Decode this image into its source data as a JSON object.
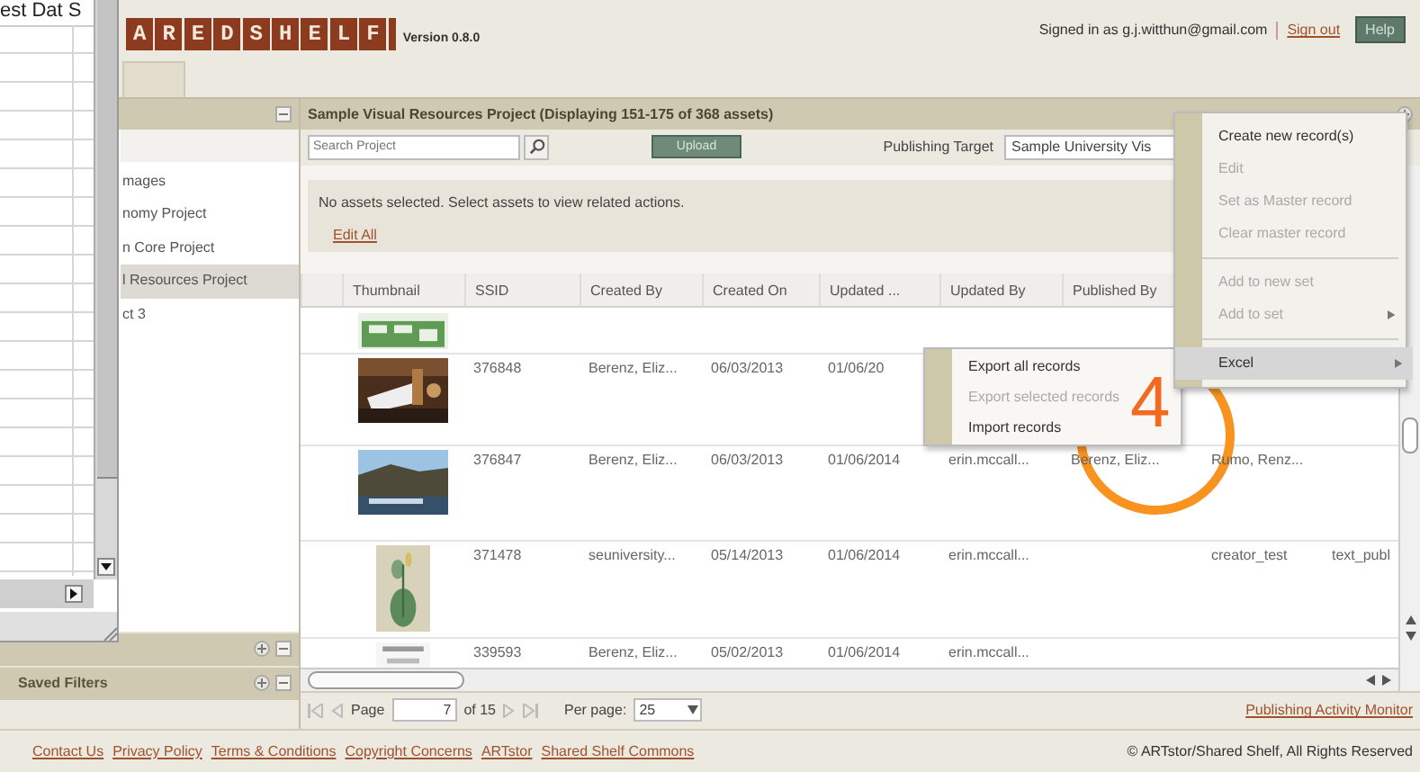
{
  "spreadsheet": {
    "header": "est Dat S"
  },
  "header": {
    "logo": "AREDSHELF",
    "version": "Version 0.8.0",
    "signed_in": "Signed in as g.j.witthun@gmail.com",
    "sign_out": "Sign out",
    "help": "Help"
  },
  "projects": [
    {
      "label": "mages",
      "selected": false
    },
    {
      "label": "nomy Project",
      "selected": false
    },
    {
      "label": "n Core Project",
      "selected": false
    },
    {
      "label": "l Resources Project",
      "selected": true
    },
    {
      "label": "ct 3",
      "selected": false
    }
  ],
  "saved_filters": "Saved Filters",
  "main": {
    "title": "Sample Visual Resources Project (Displaying 151-175 of 368 assets)",
    "search_placeholder": "Search Project",
    "upload": "Upload",
    "publishing_label": "Publishing Target",
    "publishing_value": "Sample University Vis",
    "notice": "No assets selected.  Select assets to view related actions.",
    "edit_all": "Edit All"
  },
  "table": {
    "columns": [
      "Thumbnail",
      "SSID",
      "Created By",
      "Created On",
      "Updated ...",
      "Updated By",
      "Published By"
    ],
    "rows": [
      {
        "cells": [
          {
            "kind": "picture"
          },
          null,
          null,
          null,
          null,
          null,
          null,
          null,
          null
        ]
      },
      {
        "cells": [
          {
            "kind": "picture"
          },
          "376848",
          "Berenz, Eliz...",
          "06/03/2013",
          "01/06/20",
          null,
          null,
          null,
          null
        ]
      },
      {
        "cells": [
          {
            "kind": "picture"
          },
          "376847",
          "Berenz, Eliz...",
          "06/03/2013",
          "01/06/2014",
          "erin.mccall...",
          "Berenz, Eliz...",
          "Rumo, Renz...",
          null
        ]
      },
      {
        "cells": [
          {
            "kind": "picture"
          },
          "371478",
          "seuniversity...",
          "05/14/2013",
          "01/06/2014",
          "erin.mccall...",
          null,
          "creator_test",
          "text_publ"
        ]
      },
      {
        "cells": [
          {
            "kind": "picture"
          },
          "339593",
          "Berenz, Eliz...",
          "05/02/2013",
          "01/06/2014",
          "erin.mccall...",
          null,
          null,
          null
        ]
      }
    ]
  },
  "pager": {
    "page_label": "Page",
    "page": "7",
    "of": "of 15",
    "per_page_label": "Per page:",
    "per_page": "25",
    "monitor": "Publishing Activity Monitor"
  },
  "footer": {
    "links": [
      "Contact Us",
      "Privacy Policy",
      "Terms & Conditions",
      "Copyright Concerns",
      "ARTstor",
      "Shared Shelf Commons"
    ],
    "copyright": "© ARTstor/Shared Shelf, All Rights Reserved"
  },
  "menu": [
    {
      "kind": "item",
      "label": "Create new record(s)",
      "disabled": false,
      "submenu": false,
      "selected": false
    },
    {
      "kind": "item",
      "label": "Edit",
      "disabled": true,
      "submenu": false,
      "selected": false
    },
    {
      "kind": "item",
      "label": "Set as Master record",
      "disabled": true,
      "submenu": false,
      "selected": false
    },
    {
      "kind": "item",
      "label": "Clear master record",
      "disabled": true,
      "submenu": false,
      "selected": false
    },
    {
      "kind": "separator"
    },
    {
      "kind": "item",
      "label": "Add to new set",
      "disabled": true,
      "submenu": false,
      "selected": false
    },
    {
      "kind": "item",
      "label": "Add to set",
      "disabled": true,
      "submenu": true,
      "selected": false
    },
    {
      "kind": "separator"
    },
    {
      "kind": "item",
      "label": "Excel",
      "disabled": false,
      "submenu": true,
      "selected": true
    }
  ],
  "submenu": [
    {
      "label": "Export all records",
      "disabled": false
    },
    {
      "label": "Export selected records",
      "disabled": true
    },
    {
      "label": "Import records",
      "disabled": false
    }
  ],
  "annotation": "4"
}
